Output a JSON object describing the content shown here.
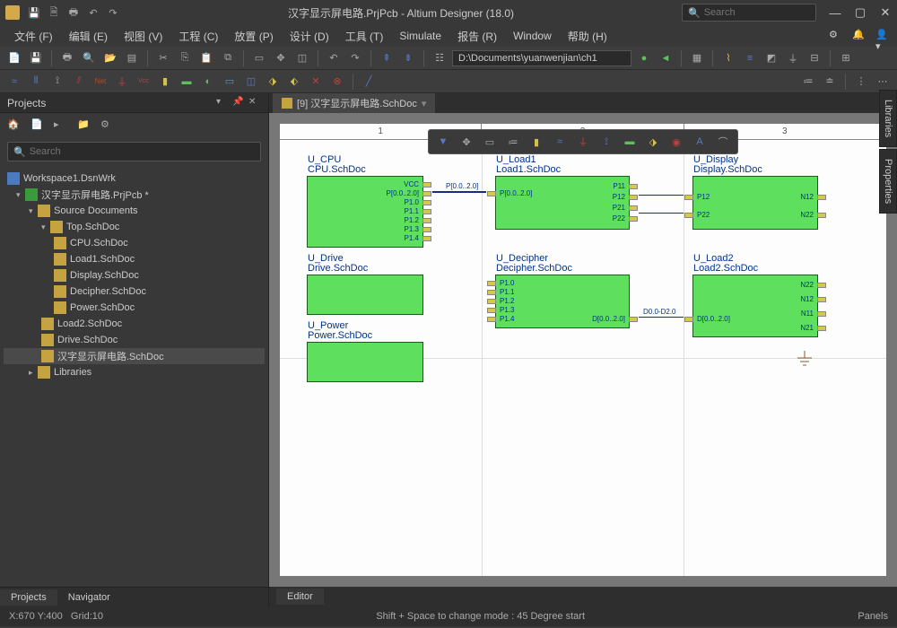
{
  "titlebar": {
    "title": "汉字显示屏电路.PrjPcb - Altium Designer (18.0)",
    "search_placeholder": "Search"
  },
  "menu": {
    "items": [
      "文件 (F)",
      "编辑 (E)",
      "视图 (V)",
      "工程 (C)",
      "放置 (P)",
      "设计 (D)",
      "工具 (T)",
      "Simulate",
      "报告 (R)",
      "Window",
      "帮助 (H)"
    ]
  },
  "toolbar": {
    "path": "D:\\Documents\\yuanwenjian\\ch1"
  },
  "projects": {
    "title": "Projects",
    "search_placeholder": "Search",
    "tree": {
      "workspace": "Workspace1.DsnWrk",
      "project": "汉字显示屏电路.PrjPcb *",
      "source_folder": "Source Documents",
      "top": "Top.SchDoc",
      "docs": [
        "CPU.SchDoc",
        "Load1.SchDoc",
        "Display.SchDoc",
        "Decipher.SchDoc",
        "Power.SchDoc"
      ],
      "extra": [
        "Load2.SchDoc",
        "Drive.SchDoc"
      ],
      "selected": "汉字显示屏电路.SchDoc",
      "libraries": "Libraries"
    },
    "tabs": {
      "projects": "Projects",
      "navigator": "Navigator"
    }
  },
  "doc_tab": "[9] 汉字显示屏电路.SchDoc",
  "ruler": [
    "1",
    "2",
    "3"
  ],
  "blocks": {
    "cpu": {
      "name": "U_CPU",
      "doc": "CPU.SchDoc",
      "pins": [
        "VCC",
        "P[0.0..2.0]",
        "P1.0",
        "P1.1",
        "P1.2",
        "P1.3",
        "P1.4"
      ]
    },
    "drive": {
      "name": "U_Drive",
      "doc": "Drive.SchDoc"
    },
    "power": {
      "name": "U_Power",
      "doc": "Power.SchDoc"
    },
    "load1": {
      "name": "U_Load1",
      "doc": "Load1.SchDoc",
      "lpins": [
        "P[0.0..2.0]"
      ],
      "rpins": [
        "P11",
        "P12",
        "P21",
        "P22"
      ]
    },
    "decipher": {
      "name": "U_Decipher",
      "doc": "Decipher.SchDoc",
      "lpins": [
        "P1.0",
        "P1.1",
        "P1.2",
        "P1.3",
        "P1.4"
      ],
      "rpins": [
        "D[0.0..2.0]"
      ],
      "net": "D0.0-D2.0"
    },
    "display": {
      "name": "U_Display",
      "doc": "Display.SchDoc",
      "lpins": [
        "P12",
        "P22"
      ],
      "rpins": [
        "N12",
        "N22"
      ]
    },
    "load2": {
      "name": "U_Load2",
      "doc": "Load2.SchDoc",
      "lpins": [
        "D[0.0..2.0]"
      ],
      "rpins": [
        "N22",
        "N12",
        "N11",
        "N21"
      ]
    }
  },
  "editor_tab": "Editor",
  "side": {
    "libraries": "Libraries",
    "properties": "Properties"
  },
  "status": {
    "coords": "X:670 Y:400",
    "grid": "Grid:10",
    "hint": "Shift + Space to change mode : 45 Degree start",
    "panels": "Panels"
  }
}
